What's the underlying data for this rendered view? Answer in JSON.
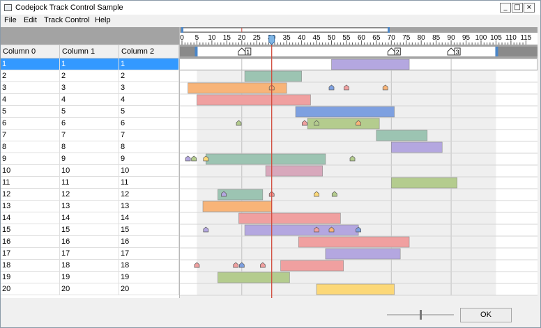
{
  "window": {
    "title": "Codejock Track Control Sample",
    "min": "_",
    "max": "□",
    "close": "×"
  },
  "menus": [
    "File",
    "Edit",
    "Track Control",
    "Help"
  ],
  "grid": {
    "columns": [
      "Column 0",
      "Column 1",
      "Column 2"
    ],
    "rows": [
      [
        "1",
        "1",
        "1"
      ],
      [
        "2",
        "2",
        "2"
      ],
      [
        "3",
        "3",
        "3"
      ],
      [
        "4",
        "4",
        "4"
      ],
      [
        "5",
        "5",
        "5"
      ],
      [
        "6",
        "6",
        "6"
      ],
      [
        "7",
        "7",
        "7"
      ],
      [
        "8",
        "8",
        "8"
      ],
      [
        "9",
        "9",
        "9"
      ],
      [
        "10",
        "10",
        "10"
      ],
      [
        "11",
        "11",
        "11"
      ],
      [
        "12",
        "12",
        "12"
      ],
      [
        "13",
        "13",
        "13"
      ],
      [
        "14",
        "14",
        "14"
      ],
      [
        "15",
        "15",
        "15"
      ],
      [
        "16",
        "16",
        "16"
      ],
      [
        "17",
        "17",
        "17"
      ],
      [
        "18",
        "18",
        "18"
      ],
      [
        "19",
        "19",
        "19"
      ],
      [
        "20",
        "20",
        "20"
      ]
    ],
    "selected_row": 0
  },
  "ruler": {
    "min": 0,
    "max": 115,
    "step": 5,
    "labels": [
      "0",
      "5",
      "10",
      "15",
      "20",
      "25",
      "30",
      "35",
      "40",
      "45",
      "50",
      "55",
      "60",
      "65",
      "70",
      "75",
      "80",
      "85",
      "90",
      "95",
      "100",
      "105",
      "110",
      "115"
    ]
  },
  "work_area": {
    "start": 5,
    "end": 105
  },
  "time_marker": 30,
  "markers": [
    {
      "label": "1",
      "pos": 20
    },
    {
      "label": "2",
      "pos": 70
    },
    {
      "label": "3",
      "pos": 90
    }
  ],
  "colors": {
    "purple": "#b4a7e0",
    "teal": "#9cc4b2",
    "orange": "#f8b478",
    "red": "#f0a0a0",
    "blue": "#7ea0e0",
    "green": "#b4cc8e",
    "pink": "#d8a8bc",
    "yellow": "#fcd878"
  },
  "blocks": [
    {
      "row": 0,
      "start": 50,
      "end": 76,
      "color": "purple"
    },
    {
      "row": 1,
      "start": 21,
      "end": 40,
      "color": "teal"
    },
    {
      "row": 2,
      "start": 2,
      "end": 35,
      "color": "orange"
    },
    {
      "row": 3,
      "start": 5,
      "end": 43,
      "color": "red"
    },
    {
      "row": 4,
      "start": 38,
      "end": 71,
      "color": "blue"
    },
    {
      "row": 5,
      "start": 42,
      "end": 66,
      "color": "green"
    },
    {
      "row": 6,
      "start": 65,
      "end": 82,
      "color": "teal"
    },
    {
      "row": 7,
      "start": 70,
      "end": 87,
      "color": "purple"
    },
    {
      "row": 8,
      "start": 8,
      "end": 48,
      "color": "teal"
    },
    {
      "row": 9,
      "start": 28,
      "end": 47,
      "color": "pink"
    },
    {
      "row": 10,
      "start": 70,
      "end": 92,
      "color": "green"
    },
    {
      "row": 11,
      "start": 12,
      "end": 27,
      "color": "teal"
    },
    {
      "row": 12,
      "start": 7,
      "end": 30,
      "color": "orange"
    },
    {
      "row": 13,
      "start": 19,
      "end": 53,
      "color": "red"
    },
    {
      "row": 14,
      "start": 21,
      "end": 59,
      "color": "purple"
    },
    {
      "row": 15,
      "start": 39,
      "end": 76,
      "color": "red"
    },
    {
      "row": 16,
      "start": 48,
      "end": 73,
      "color": "purple"
    },
    {
      "row": 17,
      "start": 33,
      "end": 54,
      "color": "red"
    },
    {
      "row": 18,
      "start": 12,
      "end": 36,
      "color": "green"
    },
    {
      "row": 19,
      "start": 45,
      "end": 71,
      "color": "yellow"
    }
  ],
  "keys": [
    {
      "row": 2,
      "pos": 30,
      "color": "orange"
    },
    {
      "row": 2,
      "pos": 50,
      "color": "blue"
    },
    {
      "row": 2,
      "pos": 55,
      "color": "red"
    },
    {
      "row": 2,
      "pos": 68,
      "color": "orange"
    },
    {
      "row": 5,
      "pos": 19,
      "color": "green"
    },
    {
      "row": 5,
      "pos": 41,
      "color": "red"
    },
    {
      "row": 5,
      "pos": 45,
      "color": "green"
    },
    {
      "row": 5,
      "pos": 59,
      "color": "orange"
    },
    {
      "row": 8,
      "pos": 2,
      "color": "purple"
    },
    {
      "row": 8,
      "pos": 4,
      "color": "green"
    },
    {
      "row": 8,
      "pos": 8,
      "color": "yellow"
    },
    {
      "row": 8,
      "pos": 57,
      "color": "green"
    },
    {
      "row": 11,
      "pos": 14,
      "color": "purple"
    },
    {
      "row": 11,
      "pos": 30,
      "color": "red"
    },
    {
      "row": 11,
      "pos": 45,
      "color": "yellow"
    },
    {
      "row": 11,
      "pos": 51,
      "color": "green"
    },
    {
      "row": 14,
      "pos": 8,
      "color": "purple"
    },
    {
      "row": 14,
      "pos": 45,
      "color": "red"
    },
    {
      "row": 14,
      "pos": 50,
      "color": "orange"
    },
    {
      "row": 14,
      "pos": 59,
      "color": "blue"
    },
    {
      "row": 17,
      "pos": 5,
      "color": "red"
    },
    {
      "row": 17,
      "pos": 18,
      "color": "red"
    },
    {
      "row": 17,
      "pos": 20,
      "color": "blue"
    },
    {
      "row": 17,
      "pos": 27,
      "color": "red"
    }
  ],
  "ok_label": "OK",
  "zoom": 0.5
}
